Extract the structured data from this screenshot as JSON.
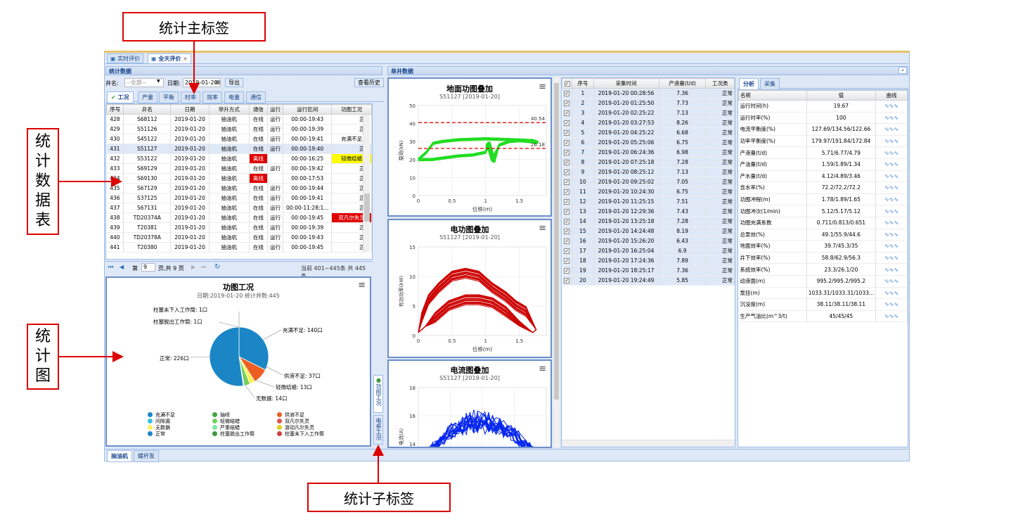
{
  "callouts": {
    "main_tab": "统计主标签",
    "data_table": [
      "统",
      "计",
      "数",
      "据",
      "表"
    ],
    "chart": [
      "统",
      "计",
      "图"
    ],
    "sub_tab": "统计子标签"
  },
  "top_tabs": [
    "实时评价",
    "全天评价"
  ],
  "left_panel": {
    "title": "统计数据",
    "well_label": "井名:",
    "well_value": "--全部--",
    "date_label": "日期:",
    "date_value": "2019-01-20",
    "export_btn": "导出",
    "history_btn": "查看历史",
    "sub_tabs": [
      "工况",
      "产量",
      "平衡",
      "时率",
      "效率",
      "电量",
      "通信"
    ],
    "columns": [
      "序号",
      "井名",
      "日期",
      "举升方式",
      "通信",
      "运行",
      "运行区间",
      "功图工况"
    ],
    "rows": [
      [
        "428",
        "S68112",
        "2019-01-20",
        "抽油机",
        "在线",
        "运行",
        "00:00-19:43",
        "正常"
      ],
      [
        "429",
        "S51126",
        "2019-01-20",
        "抽油机",
        "在线",
        "运行",
        "00:00-19:39",
        "正常"
      ],
      [
        "430",
        "S45122",
        "2019-01-20",
        "抽油机",
        "在线",
        "运行",
        "00:00-19:41",
        "充满不足"
      ],
      [
        "431",
        "S51127",
        "2019-01-20",
        "抽油机",
        "在线",
        "运行",
        "00:00-19:40",
        "正常"
      ],
      [
        "432",
        "S53122",
        "2019-01-20",
        "抽油机",
        "离线",
        "",
        "00:00-16:25",
        "轻微结蜡"
      ],
      [
        "433",
        "S69129",
        "2019-01-20",
        "抽油机",
        "在线",
        "运行",
        "00:00-19:42",
        "正常"
      ],
      [
        "434",
        "S69130",
        "2019-01-20",
        "抽油机",
        "离线",
        "",
        "00:00-17:53",
        "正常"
      ],
      [
        "435",
        "S67129",
        "2019-01-20",
        "抽油机",
        "在线",
        "运行",
        "00:00-19:44",
        "正常"
      ],
      [
        "436",
        "S37125",
        "2019-01-20",
        "抽油机",
        "在线",
        "运行",
        "00:00-19:41",
        "正常"
      ],
      [
        "437",
        "S67131",
        "2019-01-20",
        "抽油机",
        "在线",
        "运行",
        "00:00-11:28;1...",
        "正常"
      ],
      [
        "438",
        "TD20374A",
        "2019-01-20",
        "抽油机",
        "在线",
        "运行",
        "00:00-19:45",
        "双凡尔失灵"
      ],
      [
        "439",
        "T20381",
        "2019-01-20",
        "抽油机",
        "在线",
        "运行",
        "00:00-19:39",
        "正常"
      ],
      [
        "440",
        "TD20378A",
        "2019-01-20",
        "抽油机",
        "在线",
        "运行",
        "00:00-19:43",
        "正常"
      ],
      [
        "441",
        "T20380",
        "2019-01-20",
        "抽油机",
        "在线",
        "运行",
        "00:00-19:45",
        "正常"
      ]
    ],
    "pager": {
      "page_prefix": "第",
      "page": "9",
      "page_suffix": "页,共 9 页",
      "summary": "当前 401~445条 共 445 条"
    },
    "side_tabs": [
      "功图工况",
      "电参工况"
    ],
    "bottom_tabs": [
      "抽油机",
      "螺杆泵"
    ]
  },
  "pie_chart": {
    "title": "功图工况",
    "subtitle": "日期:2019-01-20 统计井数:445",
    "labels": {
      "l1": "柱塞未下入工作筒: 1口",
      "l2": "柱塞脱出工作筒: 1口",
      "l3": "充满不足: 140口",
      "l4": "正常: 226口",
      "l5": "供液不足: 37口",
      "l6": "轻微结蜡: 13口",
      "l7": "无数据: 14口"
    },
    "legend": [
      "充满不足",
      "抽喷",
      "供液不足",
      "间隙漏",
      "轻微结蜡",
      "双凡尔失灵",
      "无数据",
      "严重结蜡",
      "游动凡尔失灵",
      "正常",
      "柱塞脱出工作筒",
      "柱塞未下入工作筒"
    ]
  },
  "chart_data": [
    {
      "type": "pie",
      "title": "功图工况",
      "subtitle": "日期:2019-01-20 统计井数:445",
      "categories": [
        "充满不足",
        "正常",
        "供液不足",
        "轻微结蜡",
        "无数据",
        "柱塞脱出工作筒",
        "柱塞未下入工作筒"
      ],
      "values": [
        140,
        226,
        37,
        13,
        14,
        1,
        1
      ],
      "colors": [
        "#1a86c6",
        "#1a86c6",
        "#ec5e24",
        "#fff15c",
        "#74d05c",
        "#444444",
        "#888888"
      ]
    },
    {
      "type": "line",
      "title": "地面功图叠加",
      "subtitle": "S51127 [2019-01-20]",
      "xlabel": "位移(m)",
      "ylabel": "载荷(kN)",
      "xlim": [
        0,
        1.9
      ],
      "ylim": [
        0,
        50
      ],
      "xticks": [
        "0",
        "0.5",
        "1",
        "1.5"
      ],
      "yticks": [
        "0",
        "10",
        "20",
        "30",
        "40",
        "50"
      ],
      "reference_lines": [
        40.54,
        26.18
      ],
      "series_color": "#22dd22"
    },
    {
      "type": "line",
      "title": "电功图叠加",
      "subtitle": "S51127 [2019-01-20]",
      "xlabel": "位移(m)",
      "ylabel": "有功功率(kW)",
      "xlim": [
        0,
        1.9
      ],
      "ylim": [
        0,
        15
      ],
      "xticks": [
        "0",
        "0.5",
        "1",
        "1.5"
      ],
      "yticks": [
        "0",
        "5",
        "10",
        "15"
      ],
      "series_color": "#cc0000"
    },
    {
      "type": "line",
      "title": "电流图叠加",
      "subtitle": "S51127 [2019-01-20]",
      "ylabel": "电流(A)",
      "ylim": [
        14,
        18
      ],
      "yticks": [
        "14",
        "16",
        "18"
      ],
      "series_color": "#0022ee"
    }
  ],
  "single_panel": {
    "title": "单井数据"
  },
  "acq_table": {
    "columns": [
      "序号",
      "采集时间",
      "产液量(t/d)",
      "工况类"
    ],
    "rows": [
      [
        "1",
        "2019-01-20 00:28:56",
        "7.36",
        "正常"
      ],
      [
        "2",
        "2019-01-20 01:25:50",
        "7.73",
        "正常"
      ],
      [
        "3",
        "2019-01-20 02:25:22",
        "7.13",
        "正常"
      ],
      [
        "4",
        "2019-01-20 03:27:53",
        "8.26",
        "正常"
      ],
      [
        "5",
        "2019-01-20 04:25:22",
        "6.68",
        "正常"
      ],
      [
        "6",
        "2019-01-20 05:25:06",
        "6.75",
        "正常"
      ],
      [
        "7",
        "2019-01-20 06:24:36",
        "6.98",
        "正常"
      ],
      [
        "8",
        "2019-01-20 07:25:18",
        "7.28",
        "正常"
      ],
      [
        "9",
        "2019-01-20 08:25:12",
        "7.13",
        "正常"
      ],
      [
        "10",
        "2019-01-20 09:25:02",
        "7.05",
        "正常"
      ],
      [
        "11",
        "2019-01-20 10:24:30",
        "6.75",
        "正常"
      ],
      [
        "12",
        "2019-01-20 11:25:15",
        "7.51",
        "正常"
      ],
      [
        "13",
        "2019-01-20 12:29:36",
        "7.43",
        "正常"
      ],
      [
        "14",
        "2019-01-20 13:25:18",
        "7.28",
        "正常"
      ],
      [
        "15",
        "2019-01-20 14:24:48",
        "8.19",
        "正常"
      ],
      [
        "16",
        "2019-01-20 15:26:20",
        "6.43",
        "正常"
      ],
      [
        "17",
        "2019-01-20 16:25:04",
        "6.9",
        "正常"
      ],
      [
        "18",
        "2019-01-20 17:24:36",
        "7.89",
        "正常"
      ],
      [
        "19",
        "2019-01-20 18:25:17",
        "7.36",
        "正常"
      ],
      [
        "20",
        "2019-01-20 19:24:49",
        "5.85",
        "正常"
      ]
    ]
  },
  "analysis": {
    "tabs": [
      "分析",
      "采集"
    ],
    "columns": [
      "名称",
      "值",
      "曲线"
    ],
    "rows": [
      [
        "运行时间(h)",
        "19.67"
      ],
      [
        "运行时率(%)",
        "100"
      ],
      [
        "电流平衡度(%)",
        "127.69/134.56/122.66"
      ],
      [
        "功率平衡度(%)",
        "179.97/191.84/172.84"
      ],
      [
        "产液量(t/d)",
        "5.71/6.77/4.79"
      ],
      [
        "产油量(t/d)",
        "1.59/1.89/1.34"
      ],
      [
        "产水量(t/d)",
        "4.12/4.89/3.46"
      ],
      [
        "含水率(%)",
        "72.2/72.2/72.2"
      ],
      [
        "功图冲程(m)",
        "1.78/1.89/1.65"
      ],
      [
        "功图冲次(1/min)",
        "5.12/5.17/5.12"
      ],
      [
        "功图充满系数",
        "0.711/0.813/0.651"
      ],
      [
        "总泵效(%)",
        "49.1/55.9/44.6"
      ],
      [
        "地面效率(%)",
        "39.7/45.3/35"
      ],
      [
        "井下效率(%)",
        "58.8/62.9/56.3"
      ],
      [
        "系统效率(%)",
        "23.3/26.1/20"
      ],
      [
        "动液面(m)",
        "995.2/995.2/995.2"
      ],
      [
        "泵挂(m)",
        "1033.31/1033.31/1033..."
      ],
      [
        "沉没度(m)",
        "38.11/38.11/38.11"
      ],
      [
        "生产气油比(m^3/t)",
        "45/45/45"
      ]
    ]
  }
}
